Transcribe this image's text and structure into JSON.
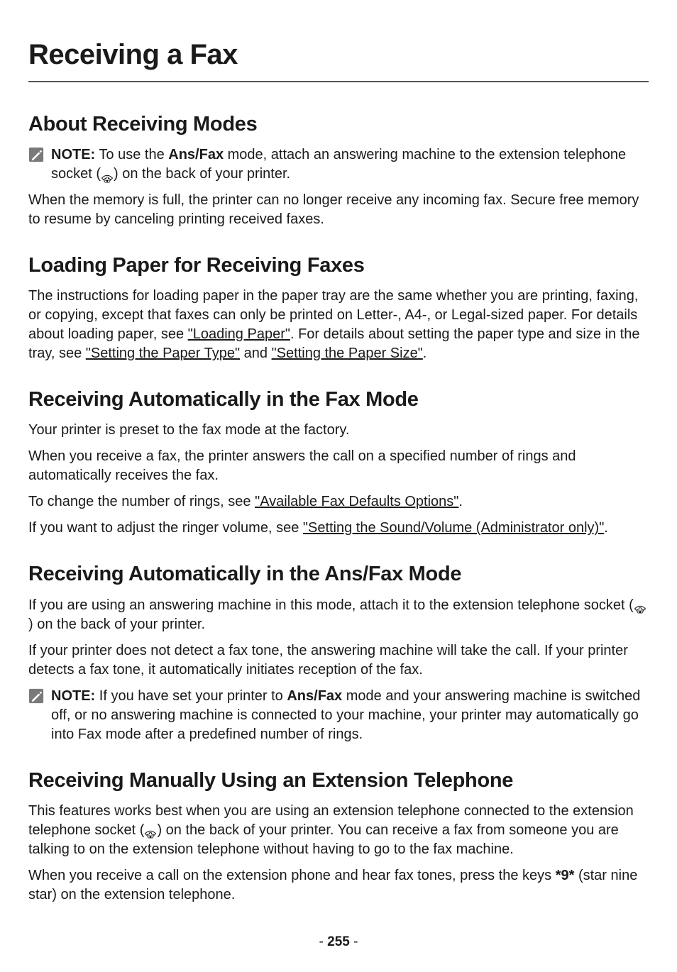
{
  "page_title": "Receiving a Fax",
  "sections": {
    "about_modes": {
      "heading": "About Receiving Modes",
      "note_label": "NOTE:",
      "note_pre": " To use the ",
      "note_bold": "Ans/Fax",
      "note_post1": " mode, attach an answering machine to the extension telephone socket (",
      "note_post2": ") on the back of your printer.",
      "para2": "When the memory is full, the printer can no longer receive any incoming fax. Secure free memory to resume by canceling printing received faxes."
    },
    "loading_paper": {
      "heading": "Loading Paper for Receiving Faxes",
      "para_pre": "The instructions for loading paper in the paper tray are the same whether you are printing, faxing, or copying, except that faxes can only be printed on Letter-, A4-, or Legal-sized paper. For details about loading paper, see ",
      "link1": "\"Loading Paper\"",
      "para_mid1": ". For details about setting the paper type and size in the tray, see ",
      "link2": "\"Setting the Paper Type\"",
      "para_mid2": " and ",
      "link3": "\"Setting the Paper Size\"",
      "para_end": "."
    },
    "auto_fax": {
      "heading": "Receiving Automatically in the Fax Mode",
      "para1": "Your printer is preset to the fax mode at the factory.",
      "para2": "When you receive a fax, the printer answers the call on a specified number of rings and automatically receives the fax.",
      "para3_pre": "To change the number of rings, see ",
      "para3_link": "\"Available Fax Defaults Options\"",
      "para3_post": ".",
      "para4_pre": "If you want to adjust the ringer volume, see ",
      "para4_link": "\"Setting the Sound/Volume (Administrator only)\"",
      "para4_post": "."
    },
    "auto_ansfax": {
      "heading": "Receiving Automatically in the Ans/Fax Mode",
      "para1_pre": "If you are using an answering machine in this mode, attach it to the extension telephone socket (",
      "para1_post": ") on the back of your printer.",
      "para2": "If your printer does not detect a fax tone, the answering machine will take the call. If your printer detects a fax tone, it automatically initiates reception of the fax.",
      "note_label": "NOTE:",
      "note_pre": " If you have set your printer to ",
      "note_bold": "Ans/Fax",
      "note_post": " mode and your answering machine is switched off, or no answering machine is connected to your machine, your printer may automatically go into Fax mode after a predefined number of rings."
    },
    "manual_ext": {
      "heading": "Receiving Manually Using an Extension Telephone",
      "para1_pre": "This features works best when you are using an extension telephone connected to the extension telephone socket (",
      "para1_post": ") on the back of your printer. You can receive a fax from someone you are talking to on the extension telephone without having to go to the fax machine.",
      "para2_pre": "When you receive a call on the extension phone and hear fax tones, press the keys ",
      "para2_bold": "*9*",
      "para2_post": " (star nine star) on the extension telephone."
    }
  },
  "page_number_prefix": "- ",
  "page_number": "255",
  "page_number_suffix": " -"
}
